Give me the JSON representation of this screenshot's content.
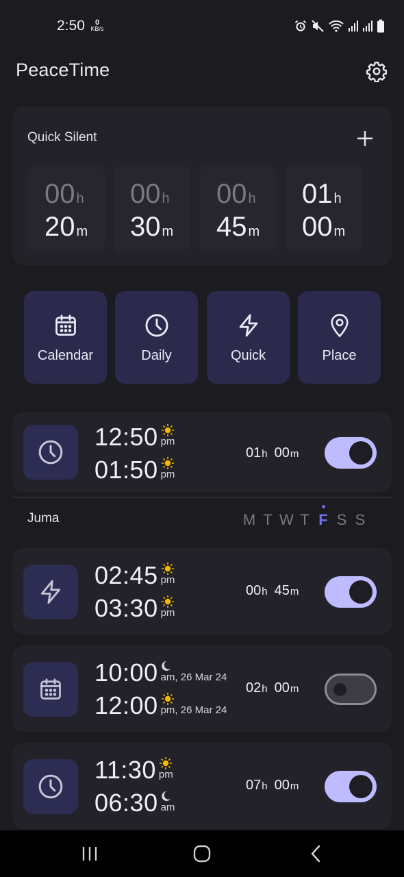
{
  "status_bar": {
    "time": "2:50",
    "net_speed_value": "0",
    "net_speed_unit": "KB/s",
    "icons": [
      "alarm-icon",
      "mute-icon",
      "wifi-icon",
      "signal-icon",
      "signal-icon",
      "battery-icon"
    ]
  },
  "header": {
    "title": "PeaceTime",
    "settings_icon": "gear-icon"
  },
  "quick_silent": {
    "title": "Quick Silent",
    "add_icon": "plus-icon",
    "hour_unit": "h",
    "minute_unit": "m",
    "tiles": [
      {
        "hours": "00",
        "minutes": "20"
      },
      {
        "hours": "00",
        "minutes": "30"
      },
      {
        "hours": "00",
        "minutes": "45"
      },
      {
        "hours": "01",
        "minutes": "00"
      }
    ]
  },
  "modes": [
    {
      "label": "Calendar",
      "icon": "calendar-icon"
    },
    {
      "label": "Daily",
      "icon": "clock-icon"
    },
    {
      "label": "Quick",
      "icon": "lightning-icon"
    },
    {
      "label": "Place",
      "icon": "location-pin-icon"
    }
  ],
  "day_section": {
    "label": "Juma",
    "days": [
      "M",
      "T",
      "W",
      "T",
      "F",
      "S",
      "S"
    ],
    "active_day_index": 4
  },
  "schedules": [
    {
      "type_icon": "clock-icon",
      "start_time": "12:50",
      "start_meta": "pm",
      "start_symbol": "sun-icon",
      "end_time": "01:50",
      "end_meta": "pm",
      "end_symbol": "sun-icon",
      "dur_h": "01",
      "dur_m": "00",
      "unit_h": "h",
      "unit_m": "m",
      "enabled": true
    },
    {
      "type_icon": "lightning-icon",
      "start_time": "02:45",
      "start_meta": "pm",
      "start_symbol": "sun-icon",
      "end_time": "03:30",
      "end_meta": "pm",
      "end_symbol": "sun-icon",
      "dur_h": "00",
      "dur_m": "45",
      "unit_h": "h",
      "unit_m": "m",
      "enabled": true
    },
    {
      "type_icon": "calendar-icon",
      "start_time": "10:00",
      "start_meta": "am, 26 Mar 24",
      "start_symbol": "moon-icon",
      "end_time": "12:00",
      "end_meta": "pm, 26 Mar 24",
      "end_symbol": "sun-icon",
      "dur_h": "02",
      "dur_m": "00",
      "unit_h": "h",
      "unit_m": "m",
      "enabled": false
    },
    {
      "type_icon": "clock-icon",
      "start_time": "11:30",
      "start_meta": "pm",
      "start_symbol": "sun-icon",
      "end_time": "06:30",
      "end_meta": "am",
      "end_symbol": "moon-icon",
      "dur_h": "07",
      "dur_m": "00",
      "unit_h": "h",
      "unit_m": "m",
      "enabled": true
    }
  ],
  "nav_bar": {
    "icons": [
      "recent-apps-icon",
      "home-icon",
      "back-icon"
    ]
  },
  "colors": {
    "background": "#1c1b20",
    "card": "#232229",
    "mode_button": "#2b2a4d",
    "toggle_on": "#bebcff",
    "active_day": "#6f6cf0",
    "sun": "#f5b800"
  }
}
